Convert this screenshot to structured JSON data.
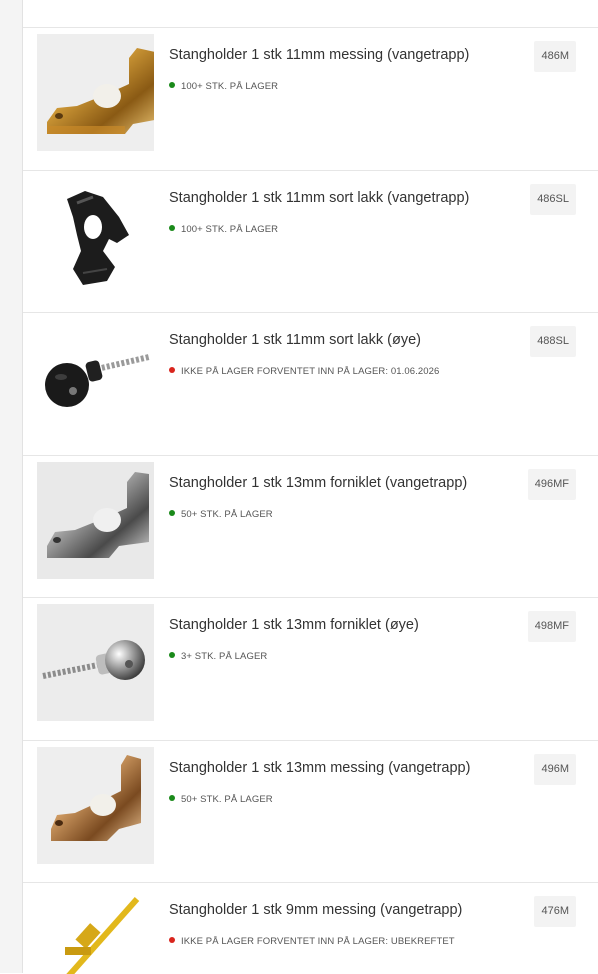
{
  "products": [
    {
      "title": "Stangholder 1 stk 11mm messing (vangetrapp)",
      "stock": "100+ STK. PÅ LAGER",
      "status": "green",
      "sku": "486M",
      "image": "brass-bracket-image"
    },
    {
      "title": "Stangholder 1 stk 11mm sort lakk (vangetrapp)",
      "stock": "100+ STK. PÅ LAGER",
      "status": "green",
      "sku": "486SL",
      "image": "black-bracket-image"
    },
    {
      "title": "Stangholder 1 stk 11mm sort lakk (øye)",
      "stock": "IKKE PÅ LAGER FORVENTET INN PÅ LAGER: 01.06.2026",
      "status": "red",
      "sku": "488SL",
      "image": "black-eye-screw-image"
    },
    {
      "title": "Stangholder 1 stk 13mm forniklet (vangetrapp)",
      "stock": "50+ STK. PÅ LAGER",
      "status": "green",
      "sku": "496MF",
      "image": "nickel-bracket-image"
    },
    {
      "title": "Stangholder 1 stk 13mm forniklet (øye)",
      "stock": "3+ STK. PÅ LAGER",
      "status": "green",
      "sku": "498MF",
      "image": "nickel-eye-screw-image"
    },
    {
      "title": "Stangholder 1 stk 13mm messing (vangetrapp)",
      "stock": "50+ STK. PÅ LAGER",
      "status": "green",
      "sku": "496M",
      "image": "brass-bracket-image"
    },
    {
      "title": "Stangholder 1 stk 9mm messing (vangetrapp)",
      "stock": "IKKE PÅ LAGER FORVENTET INN PÅ LAGER: UBEKREFTET",
      "status": "red",
      "sku": "476M",
      "image": "brass-rod-image"
    }
  ]
}
